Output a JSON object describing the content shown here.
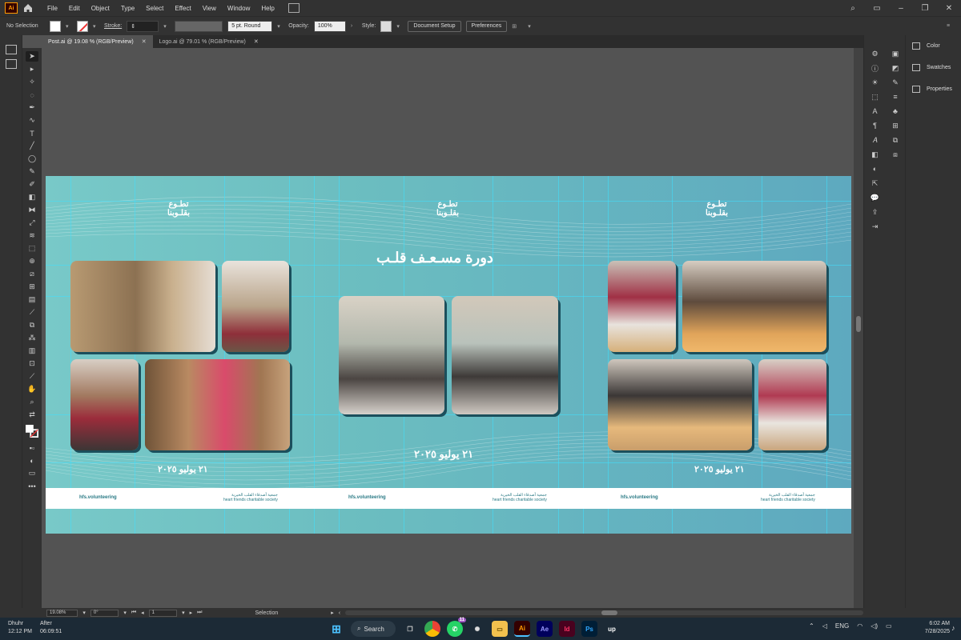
{
  "app": {
    "logo": "Ai"
  },
  "menu": [
    "File",
    "Edit",
    "Object",
    "Type",
    "Select",
    "Effect",
    "View",
    "Window",
    "Help"
  ],
  "control_bar": {
    "selection": "No Selection",
    "stroke_label": "Stroke:",
    "brush": "5 pt. Round",
    "opacity_label": "Opacity:",
    "opacity_value": "100%",
    "style_label": "Style:",
    "document_setup": "Document Setup",
    "preferences": "Preferences"
  },
  "tabs": [
    {
      "label": "Post.ai @ 19.08 % (RGB/Preview)",
      "active": true
    },
    {
      "label": "Logo.ai @ 79.01 % (RGB/Preview)",
      "active": false
    }
  ],
  "artboard": {
    "logo_line1": "تطـوع",
    "logo_line2": "بقلـوبنا",
    "course_title": "دورة مسـعـف قلـب",
    "date": "٢١ يوليو ٢٠٢٥",
    "handle": "hfs.volunteering",
    "society_ar": "جمعية أصدقاء القلب الخيرية",
    "society_en": "heart friends charitable society"
  },
  "panels": [
    {
      "label": "Color",
      "icon": "color-icon"
    },
    {
      "label": "Swatches",
      "icon": "swatches-icon"
    },
    {
      "label": "Properties",
      "icon": "properties-icon"
    }
  ],
  "status_bar": {
    "zoom": "19.08%",
    "rotation": "0°",
    "artboard": "1",
    "mode": "Selection"
  },
  "taskbar": {
    "weather_left_top": "Dhuhr",
    "weather_left_bottom": "12:12 PM",
    "weather_right_top": "After",
    "weather_right_bottom": "06:09:51",
    "search": "Search",
    "whatsapp_badge": "11",
    "lang": "ENG",
    "time": "6:02 AM",
    "date": "7/28/2025"
  },
  "colors": {
    "artboard_start": "#78c9c8",
    "artboard_end": "#5ea9bf",
    "guide": "#3fe0ff",
    "ai_orange": "#ff9a00"
  }
}
